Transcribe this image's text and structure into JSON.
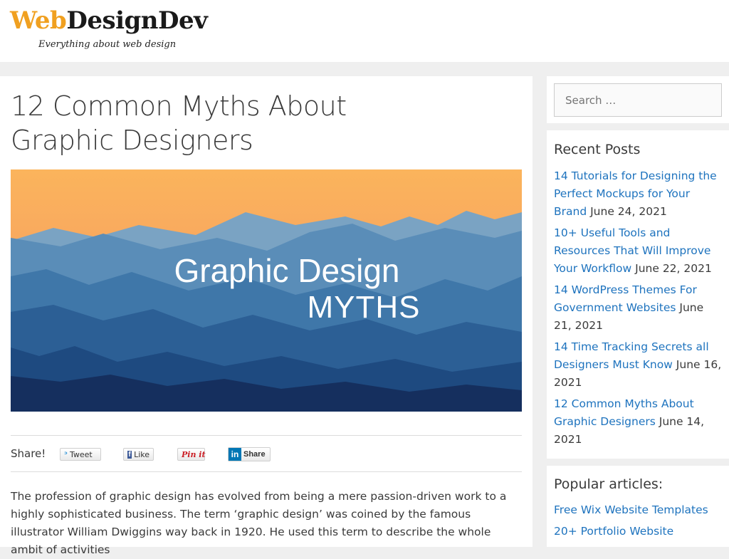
{
  "header": {
    "logo_web": "Web",
    "logo_design": "Design",
    "logo_dev": "Dev",
    "tagline": "Everything about web design"
  },
  "article": {
    "title": "12 Common Myths About Graphic Designers",
    "hero_line1": "Graphic Design",
    "hero_line2": "MYTHS",
    "share_label": "Share!",
    "share_buttons": {
      "tweet": "Tweet",
      "like": "Like",
      "pin": "Pin it",
      "linkedin": "Share"
    },
    "body": {
      "p1": "The profession of graphic design has evolved from being a mere passion-driven work to a highly sophisticated business. The term ‘graphic design’ was coined by the famous illustrator William Dwiggins way back in 1920. He used this term to describe the whole ambit of activities"
    }
  },
  "sidebar": {
    "search_placeholder": "Search …",
    "recent_title": "Recent Posts",
    "recent_posts": [
      {
        "title": "14 Tutorials for Designing the Perfect Mockups for Your Brand",
        "date": "June 24, 2021"
      },
      {
        "title": "10+ Useful Tools and Resources That Will Improve Your Workflow",
        "date": "June 22, 2021"
      },
      {
        "title": "14 WordPress Themes For Government Websites",
        "date": "June 21, 2021"
      },
      {
        "title": "14 Time Tracking Secrets all Designers Must Know",
        "date": "June 16, 2021"
      },
      {
        "title": "12 Common Myths About Graphic Designers",
        "date": "June 14, 2021"
      }
    ],
    "popular_title": "Popular articles:",
    "popular_articles": [
      "Free Wix Website Templates",
      "20+ Portfolio Website"
    ]
  },
  "colors": {
    "link": "#1e73be",
    "text": "#3a3a3a",
    "page_bg": "#efefef",
    "logo_orange": "#f0a020"
  }
}
